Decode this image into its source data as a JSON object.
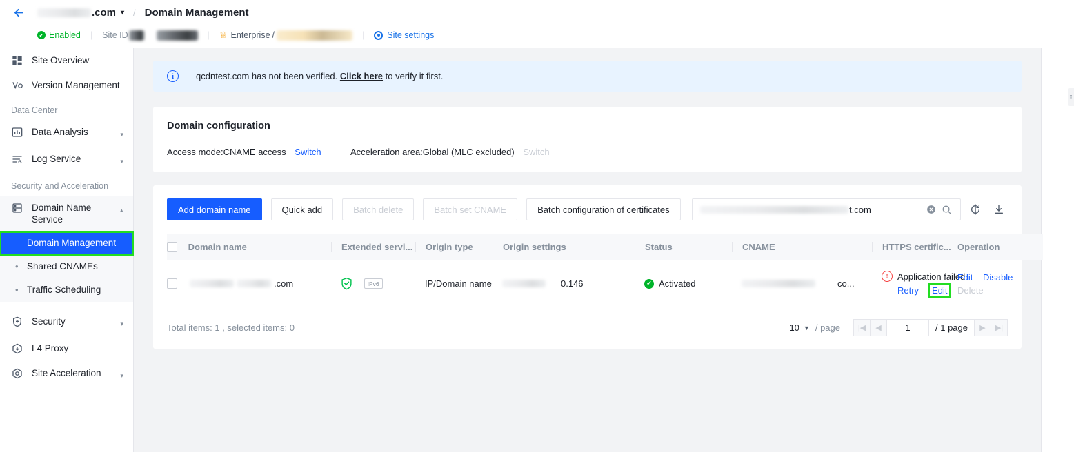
{
  "header": {
    "back_icon": "back-arrow-icon",
    "site_name_suffix": ".com",
    "caret_icon": "chevron-down-icon",
    "separator": "/",
    "page_title": "Domain Management",
    "status_label": "Enabled",
    "site_id_label": "Site ID",
    "plan_icon": "crown-icon",
    "plan_label": "Enterprise",
    "plan_separator": "/",
    "site_settings_label": "Site settings"
  },
  "sidebar": {
    "items": [
      {
        "label": "Site Overview",
        "icon": "dashboard-icon",
        "expandable": false
      },
      {
        "label": "Version Management",
        "icon": "version-icon",
        "expandable": false
      }
    ],
    "group_data_center": "Data Center",
    "data_items": [
      {
        "label": "Data Analysis",
        "icon": "chart-icon",
        "expandable": true
      },
      {
        "label": "Log Service",
        "icon": "log-icon",
        "expandable": true
      }
    ],
    "group_security": "Security and Acceleration",
    "dns_label": "Domain Name Service",
    "dns_icon": "server-icon",
    "sub_items": [
      {
        "label": "Domain Management",
        "active": true
      },
      {
        "label": "Shared CNAMEs",
        "active": false
      },
      {
        "label": "Traffic Scheduling",
        "active": false
      }
    ],
    "bottom_items": [
      {
        "label": "Security",
        "icon": "shield-icon",
        "expandable": true
      },
      {
        "label": "L4 Proxy",
        "icon": "proxy-icon",
        "expandable": false
      },
      {
        "label": "Site Acceleration",
        "icon": "rocket-icon",
        "expandable": true
      }
    ]
  },
  "notice": {
    "icon": "info-icon",
    "text_before": "qcdntest.com has not been verified. ",
    "link": "Click here",
    "text_after": " to verify it first."
  },
  "domain_config": {
    "title": "Domain configuration",
    "access_mode_label": "Access mode:CNAME access",
    "access_mode_switch": "Switch",
    "area_label": "Acceleration area:Global (MLC excluded)",
    "area_switch": "Switch"
  },
  "toolbar": {
    "add_domain": "Add domain name",
    "quick_add": "Quick add",
    "batch_delete": "Batch delete",
    "batch_set_cname": "Batch set CNAME",
    "batch_certificates": "Batch configuration of certificates",
    "search_value_suffix": "t.com",
    "clear_icon": "clear-circle-icon",
    "search_icon": "search-icon",
    "refresh_icon": "refresh-icon",
    "download_icon": "download-icon"
  },
  "table": {
    "columns": [
      "Domain name",
      "Extended servi...",
      "Origin type",
      "Origin settings",
      "Status",
      "CNAME",
      "HTTPS certific...",
      "Operation"
    ],
    "rows": [
      {
        "domain_suffix": ".com",
        "extended_shield_icon": "shield-check-icon",
        "extended_badge": "IPv6",
        "origin_type": "IP/Domain name",
        "origin_settings": "0.146",
        "status": "Activated",
        "status_icon": "check-circle-icon",
        "cname_tail": "co...",
        "https_status": "Application failed",
        "https_icon": "error-circle-icon",
        "https_retry": "Retry",
        "https_edit": "Edit",
        "op_edit": "Edit",
        "op_disable": "Disable",
        "op_delete": "Delete"
      }
    ],
    "total_text": "Total items: 1 , selected items: 0",
    "page_size": "10",
    "per_page": "/ page",
    "first_icon": "first-page-icon",
    "prev_icon": "prev-page-icon",
    "current_page": "1",
    "total_pages": "/ 1 page",
    "next_icon": "next-page-icon",
    "last_icon": "last-page-icon"
  },
  "colors": {
    "primary": "#165dff",
    "link": "#165dff",
    "success": "#00b42a",
    "danger": "#f53f3f",
    "warning": "#f5a623",
    "highlight": "#22dd22"
  }
}
